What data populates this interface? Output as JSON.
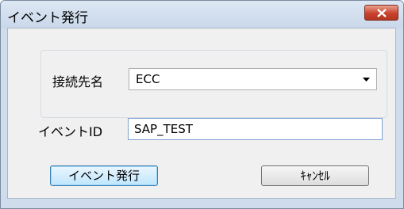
{
  "window": {
    "title": "イベント発行",
    "close_icon": "close-x-icon"
  },
  "form": {
    "connection": {
      "label": "接続先名",
      "value": "ECC",
      "arrow_icon": "chevron-down-icon"
    },
    "event_id": {
      "label": "イベントID",
      "value": "SAP_TEST"
    }
  },
  "buttons": {
    "publish_label": "イベント発行",
    "cancel_label": "ｷｬﾝｾﾙ"
  },
  "colors": {
    "title_bg": "#cfdcec",
    "close_button": "#c8432e",
    "client_bg": "#f0f0f0",
    "default_button": "#bee6fd"
  }
}
